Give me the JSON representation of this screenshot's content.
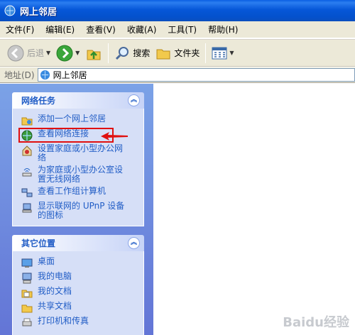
{
  "window": {
    "title": "网上邻居"
  },
  "menu": [
    "文件(F)",
    "编辑(E)",
    "查看(V)",
    "收藏(A)",
    "工具(T)",
    "帮助(H)"
  ],
  "toolbar": {
    "back_label": "后退",
    "search_label": "搜索",
    "folders_label": "文件夹"
  },
  "address": {
    "label": "地址(D)",
    "value": "网上邻居"
  },
  "network_tasks": {
    "title": "网络任务",
    "items": [
      {
        "label": "添加一个网上邻居",
        "icon": "add-network-place-icon"
      },
      {
        "label": "查看网络连接",
        "icon": "network-connections-icon"
      },
      {
        "label": "设置家庭或小型办公网络",
        "icon": "home-network-setup-icon"
      },
      {
        "label": "为家庭或小型办公室设置无线网络",
        "icon": "wireless-setup-icon"
      },
      {
        "label": "查看工作组计算机",
        "icon": "workgroup-computers-icon"
      },
      {
        "label": "显示联网的 UPnP 设备的图标",
        "icon": "upnp-device-icon"
      }
    ]
  },
  "other_places": {
    "title": "其它位置",
    "items": [
      {
        "label": "桌面",
        "icon": "desktop-icon"
      },
      {
        "label": "我的电脑",
        "icon": "my-computer-icon"
      },
      {
        "label": "我的文档",
        "icon": "my-documents-icon"
      },
      {
        "label": "共享文档",
        "icon": "shared-documents-icon"
      },
      {
        "label": "打印机和传真",
        "icon": "printers-icon"
      }
    ]
  },
  "watermark": "Baidu经验",
  "colors": {
    "title_bar": "#0451cc",
    "panel_link": "#215dc6",
    "highlight": "#e01010"
  }
}
